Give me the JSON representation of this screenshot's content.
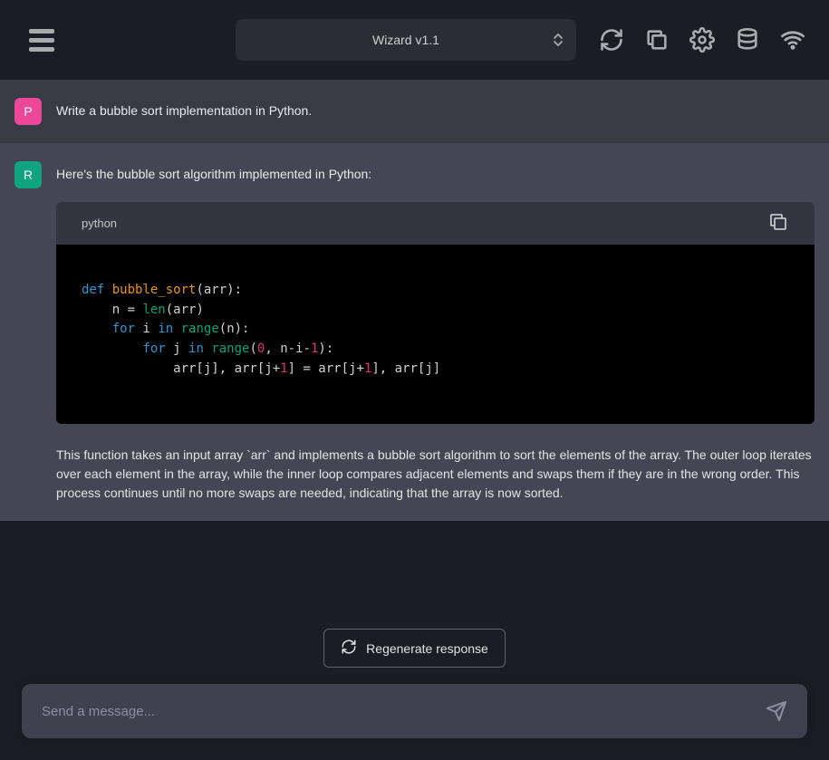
{
  "header": {
    "model_label": "Wizard v1.1"
  },
  "messages": {
    "user": {
      "avatar": "P",
      "text": "Write a bubble sort implementation in Python."
    },
    "assistant": {
      "avatar": "R",
      "intro": "Here's the bubble sort algorithm implemented in Python:",
      "code_lang": "python",
      "explanation": "This function takes an input array `arr` and implements a bubble sort algorithm to sort the elements of the array. The outer loop iterates over each element in the array, while the inner loop compares adjacent elements and swaps them if they are in the wrong order. This process continues until no more swaps are needed, indicating that the array is now sorted."
    }
  },
  "code": {
    "kw_def": "def",
    "fn_name": "bubble_sort",
    "sig_rest": "(arr):",
    "line2a": "    n = ",
    "builtin_len": "len",
    "line2b": "(arr)",
    "line3a": "    ",
    "kw_for1": "for",
    "line3b": " i ",
    "kw_in1": "in",
    "line3c": " ",
    "builtin_range1": "range",
    "line3d": "(n):",
    "line4a": "        ",
    "kw_for2": "for",
    "line4b": " j ",
    "kw_in2": "in",
    "line4c": " ",
    "builtin_range2": "range",
    "line4d": "(",
    "num0": "0",
    "line4e": ", n-i-",
    "num1a": "1",
    "line4f": "):",
    "line5a": "            arr[j], arr[j+",
    "num1b": "1",
    "line5b": "] = arr[j+",
    "num1c": "1",
    "line5c": "], arr[j]"
  },
  "footer": {
    "regen_label": "Regenerate response",
    "input_placeholder": "Send a message..."
  }
}
